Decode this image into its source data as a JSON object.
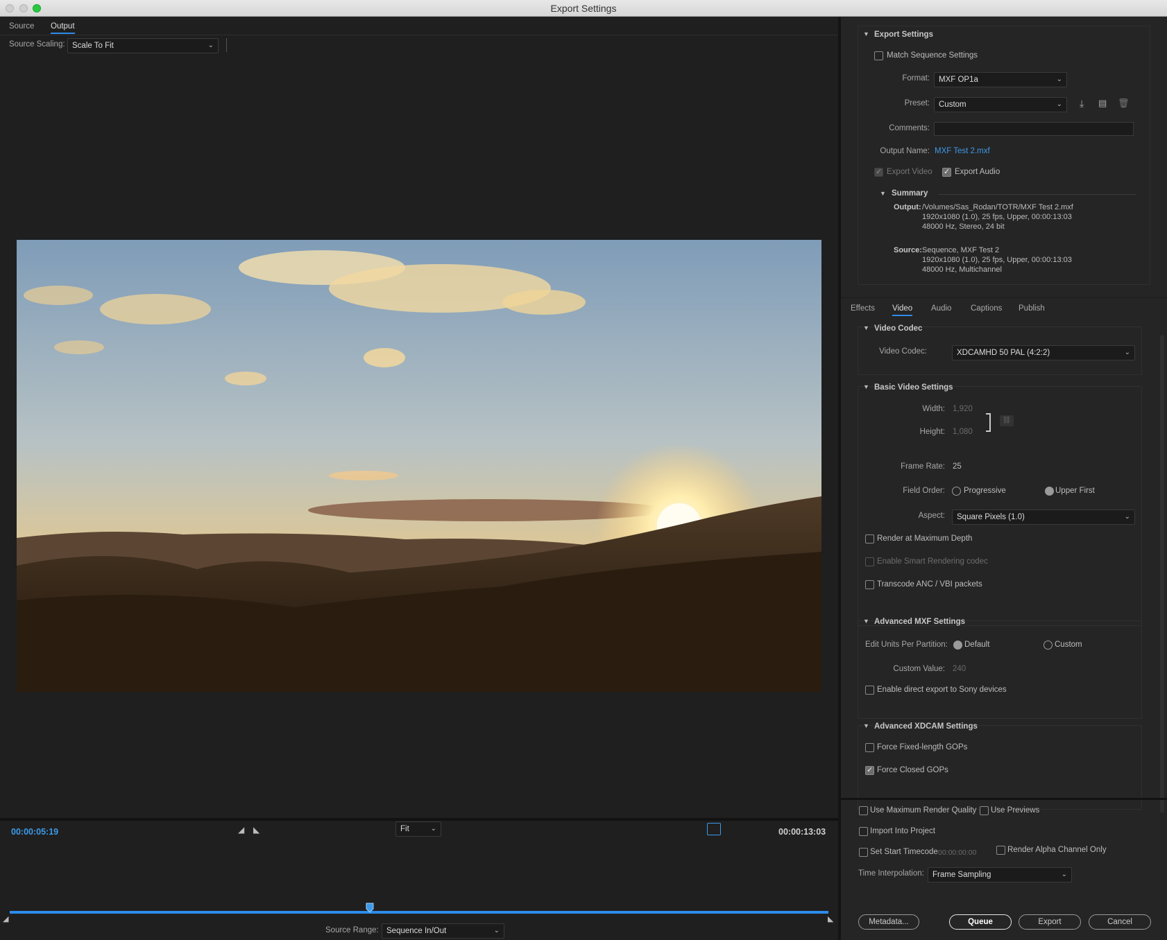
{
  "window": {
    "title": "Export Settings"
  },
  "left": {
    "tabs": {
      "source": "Source",
      "output": "Output"
    },
    "source_scaling": {
      "label": "Source Scaling:",
      "value": "Scale To Fit"
    },
    "timeline": {
      "current_time": "00:00:05:19",
      "duration": "00:00:13:03",
      "zoom": "Fit",
      "playhead_fraction": 0.44
    },
    "source_range": {
      "label": "Source Range:",
      "value": "Sequence In/Out"
    }
  },
  "export_settings": {
    "header": "Export Settings",
    "match_sequence": "Match Sequence Settings",
    "format": {
      "label": "Format:",
      "value": "MXF OP1a"
    },
    "preset": {
      "label": "Preset:",
      "value": "Custom"
    },
    "comments": {
      "label": "Comments:",
      "value": ""
    },
    "output_name": {
      "label": "Output Name:",
      "value": "MXF Test 2.mxf"
    },
    "export_video": "Export Video",
    "export_audio": "Export Audio",
    "summary": {
      "header": "Summary",
      "output_label": "Output:",
      "output_lines": [
        "/Volumes/Sas_Rodan/TOTR/MXF Test 2.mxf",
        "1920x1080 (1.0), 25 fps, Upper, 00:00:13:03",
        "48000 Hz, Stereo, 24 bit"
      ],
      "source_label": "Source:",
      "source_lines": [
        "Sequence, MXF Test 2",
        "1920x1080 (1.0), 25 fps, Upper, 00:00:13:03",
        "48000 Hz, Multichannel"
      ]
    }
  },
  "tabs": [
    "Effects",
    "Video",
    "Audio",
    "Captions",
    "Publish"
  ],
  "video_codec": {
    "header": "Video Codec",
    "label": "Video Codec:",
    "value": "XDCAMHD 50 PAL (4:2:2)"
  },
  "basic_video": {
    "header": "Basic Video Settings",
    "width_label": "Width:",
    "width": "1,920",
    "height_label": "Height:",
    "height": "1,080",
    "frame_rate_label": "Frame Rate:",
    "frame_rate": "25",
    "field_order_label": "Field Order:",
    "progressive": "Progressive",
    "upper_first": "Upper First",
    "aspect_label": "Aspect:",
    "aspect": "Square Pixels (1.0)",
    "render_max_depth": "Render at Maximum Depth",
    "smart_rendering": "Enable Smart Rendering codec",
    "transcode_anc": "Transcode ANC / VBI packets"
  },
  "advanced_mxf": {
    "header": "Advanced MXF Settings",
    "edit_units_label": "Edit Units Per Partition:",
    "default": "Default",
    "custom": "Custom",
    "custom_value_label": "Custom Value:",
    "custom_value": "240",
    "sony_export": "Enable direct export to Sony devices"
  },
  "advanced_xdcam": {
    "header": "Advanced XDCAM Settings",
    "fixed_gops": "Force Fixed-length GOPs",
    "closed_gops": "Force Closed GOPs"
  },
  "bottom": {
    "max_render_quality": "Use Maximum Render Quality",
    "use_previews": "Use Previews",
    "import_into_project": "Import Into Project",
    "set_start_timecode": "Set Start Timecode",
    "start_timecode": "00:00:00:00",
    "render_alpha": "Render Alpha Channel Only",
    "time_interp_label": "Time Interpolation:",
    "time_interp": "Frame Sampling"
  },
  "buttons": {
    "metadata": "Metadata...",
    "queue": "Queue",
    "export": "Export",
    "cancel": "Cancel"
  },
  "colors": {
    "accent": "#2d8ceb",
    "link": "#3d9ae8"
  }
}
